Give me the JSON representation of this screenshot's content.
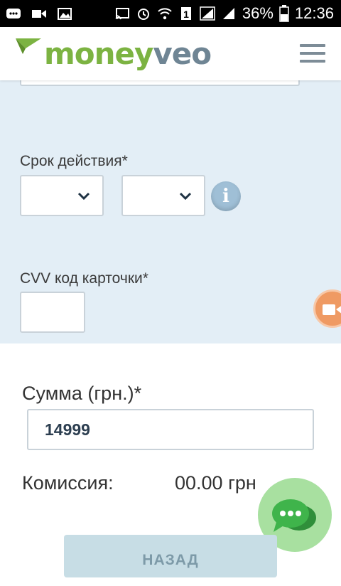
{
  "status_bar": {
    "battery": "36%",
    "time": "12:36"
  },
  "header": {
    "logo_part1": "money",
    "logo_part2": "veo"
  },
  "card_form": {
    "expiry_label": "Срок действия*",
    "cvv_label": "CVV код карточки*"
  },
  "payment": {
    "sum_label": "Сумма (грн.)*",
    "sum_value": "14999",
    "commission_label": "Комиссия:",
    "commission_value": "00.00 грн"
  },
  "back_button": "НАЗАД",
  "colors": {
    "brand_green": "#7cb342",
    "brand_gray": "#6f8594",
    "form_bg": "#e3eef6",
    "chat_green": "#a8e0a0",
    "video_orange": "#ef9a63"
  },
  "icons": [
    "menu-icon",
    "chevron-down-icon",
    "info-icon",
    "video-call-icon",
    "chat-icon"
  ]
}
